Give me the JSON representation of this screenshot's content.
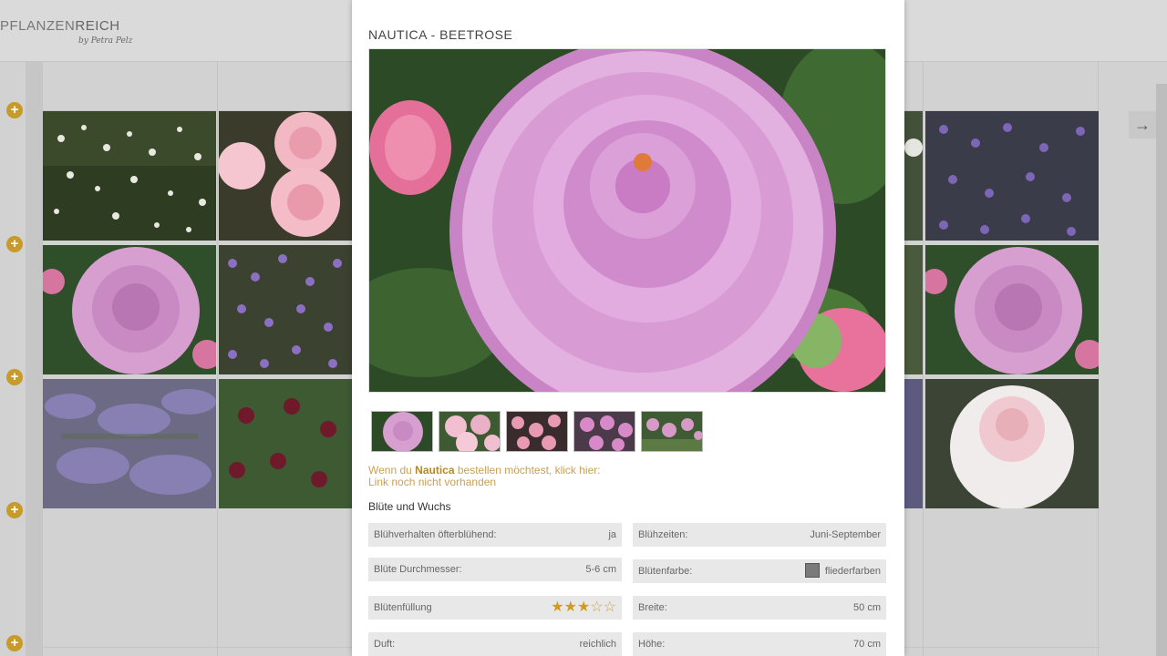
{
  "brand": {
    "name_light": "PFLANZEN",
    "name_bold": "REICH",
    "tagline": "by Petra Pelz"
  },
  "nav": {
    "next_arrow": "→"
  },
  "background": {
    "add_icon": "+",
    "add_buttons": 5,
    "tiles": [
      "daisy-meadow-photo",
      "pink-rose-cluster-photo",
      "lilac-rose-photo",
      "purple-flower-carpet-photo",
      "lavender-catmint-photo",
      "dark-red-scabious-photo",
      "blue-purple-flowers-photo",
      "lilac-rose-photo",
      "white-peony-rose-photo"
    ]
  },
  "modal": {
    "title": "NAUTICA - BEETROSE",
    "main_image": "lilac-rose-photo",
    "thumbnails": [
      "lilac-rose-closeup-thumb",
      "pink-rose-cluster-thumb",
      "pink-rose-bush-thumb",
      "pink-rose-flowers-thumb",
      "rose-garden-thumb"
    ],
    "order_prefix": "Wenn du ",
    "order_name": "Nautica",
    "order_suffix": " bestellen möchtest, klick hier:",
    "order_link": "Link noch nicht vorhanden",
    "section_title": "Blüte und Wuchs",
    "properties": [
      {
        "label": "Blühverhalten öfterblühend:",
        "value": "ja"
      },
      {
        "label": "Blühzeiten:",
        "value": "Juni-September"
      },
      {
        "label": "Blüte Durchmesser:",
        "value": "5-6 cm"
      },
      {
        "label": "Blütenfarbe:",
        "value": "fliederfarben",
        "swatch_color": "#7a7a7a"
      },
      {
        "label": "Blütenfüllung",
        "rating": 3,
        "rating_max": 5
      },
      {
        "label": "Breite:",
        "value": "50 cm"
      },
      {
        "label": "Duft:",
        "value": "reichlich"
      },
      {
        "label": "Höhe:",
        "value": "70 cm"
      }
    ]
  },
  "colors": {
    "accent": "#c79a2a",
    "link": "#c9a055",
    "property_bg": "#e7e8e7"
  }
}
